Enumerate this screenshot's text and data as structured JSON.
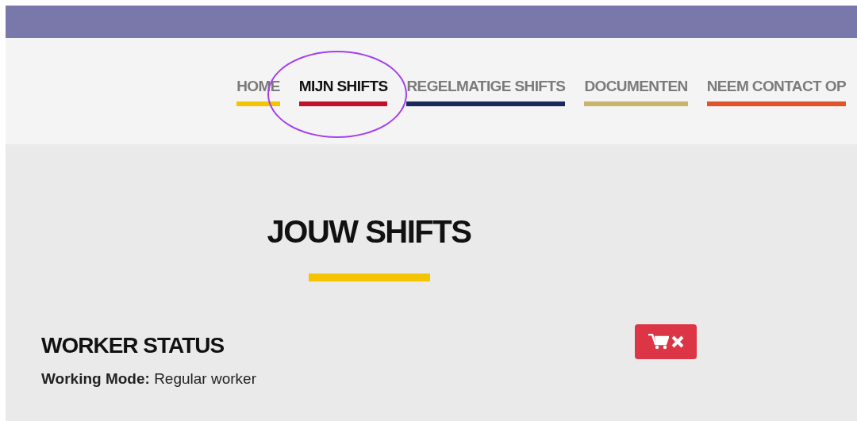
{
  "nav": {
    "items": [
      {
        "label": "HOME",
        "selected": false,
        "highlighted": false,
        "color": "#f5c400"
      },
      {
        "label": "MIJN SHIFTS",
        "selected": true,
        "highlighted": true,
        "color": "#c0122a"
      },
      {
        "label": "REGELMATIGE SHIFTS",
        "selected": false,
        "highlighted": false,
        "color": "#1b2a5c"
      },
      {
        "label": "DOCUMENTEN",
        "selected": false,
        "highlighted": false,
        "color": "#c9b46a"
      },
      {
        "label": "NEEM CONTACT OP",
        "selected": false,
        "highlighted": false,
        "color": "#e0542a"
      }
    ]
  },
  "page_title": "JOUW SHIFTS",
  "section": {
    "title": "WORKER STATUS",
    "detail": "**Working Mode:** Regular worker"
  }
}
